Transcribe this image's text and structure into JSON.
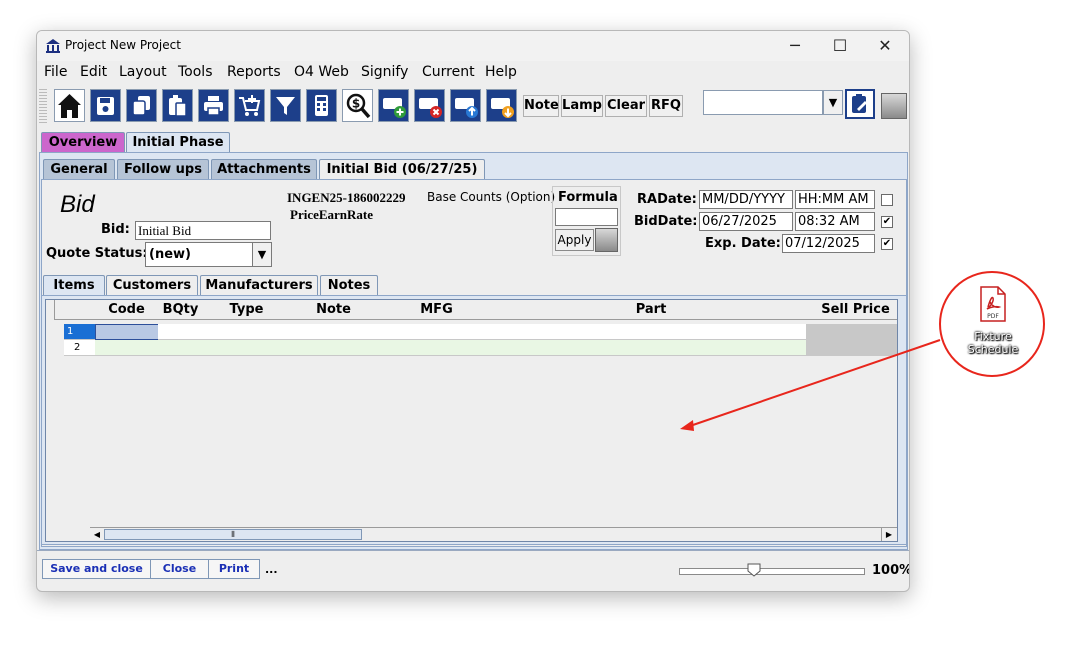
{
  "window": {
    "title": "Project New Project",
    "minimize": "─",
    "maximize": "☐",
    "close": "✕"
  },
  "menu": [
    "File",
    "Edit",
    "Layout",
    "Tools",
    "Reports",
    "O4 Web",
    "Signify",
    "Current",
    "Help"
  ],
  "toolbar": {
    "text_buttons": [
      "Note",
      "Lamp",
      "Clear",
      "RFQ"
    ],
    "search_value": ""
  },
  "phase_tabs": [
    "Overview",
    "Initial Phase"
  ],
  "sub_tabs": [
    "General",
    "Follow ups",
    "Attachments",
    "Initial Bid (06/27/25)"
  ],
  "bid": {
    "heading": "Bid",
    "bid_label": "Bid:",
    "bid_value": "Initial Bid",
    "quote_status_label": "Quote Status:",
    "quote_status_value": "(new)",
    "code": "INGEN25-186002229",
    "base_counts": "Base Counts (Option)",
    "price_earn_rate": "PriceEarnRate",
    "formula_label": "Formula",
    "apply_label": "Apply",
    "radate_label": "RADate:",
    "radate_value": "MM/DD/YYYY",
    "ratime_value": "HH:MM AM",
    "biddate_label": "BidDate:",
    "biddate_value": "06/27/2025",
    "bidtime_value": "08:32 AM",
    "expdate_label": "Exp. Date:",
    "expdate_value": "07/12/2025",
    "radate_checked": false,
    "biddate_checked": true,
    "expdate_checked": true
  },
  "item_tabs": [
    "Items",
    "Customers",
    "Manufacturers",
    "Notes"
  ],
  "grid": {
    "columns": [
      "Code",
      "BQty",
      "Type",
      "Note",
      "MFG",
      "Part",
      "Sell Price"
    ],
    "rows": [
      "1",
      "2"
    ]
  },
  "footer": {
    "buttons": [
      "Save and close",
      "Close",
      "Print"
    ],
    "ellipsis": "...",
    "zoom": "100%",
    "zoom_level": 0.4
  },
  "desktop_icon": {
    "label_line1": "Fixture",
    "label_line2": "Schedule",
    "badge": "PDF"
  },
  "colors": {
    "accent_blue": "#1a2fb5",
    "overview_tab": "#cc66cc",
    "annotation_red": "#e8261c"
  }
}
